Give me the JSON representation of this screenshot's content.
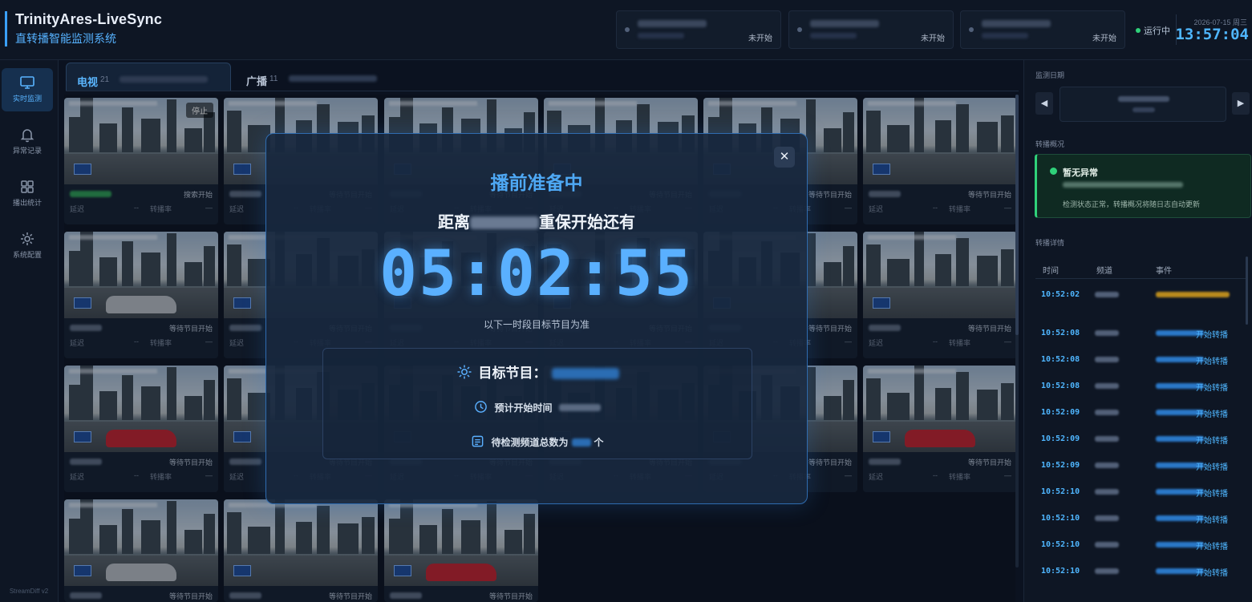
{
  "app": {
    "title": "TrinityAres-LiveSync",
    "subtitle": "直转播智能监测系统",
    "status": "运行中",
    "date": "2026-07-15 周三",
    "time": "13:57:04",
    "footnote": "StreamDiff v2"
  },
  "header_tasks": [
    {
      "state": "未开始"
    },
    {
      "state": "未开始"
    },
    {
      "state": "未开始"
    }
  ],
  "sidebar": {
    "items": [
      {
        "label": "实时监测",
        "icon": "monitor-icon",
        "active": true
      },
      {
        "label": "异常记录",
        "icon": "bell-icon"
      },
      {
        "label": "播出统计",
        "icon": "grid-icon"
      },
      {
        "label": "系统配置",
        "icon": "gear-icon"
      }
    ]
  },
  "tabs": [
    {
      "label": "电视",
      "count": "21",
      "active": true
    },
    {
      "label": "广播",
      "count": "11"
    }
  ],
  "cell_labels": {
    "stop": "停止",
    "latency": "延迟",
    "dash": "--",
    "rate": "转播率",
    "em": "—"
  },
  "channels": [
    {
      "status": "搜索开始",
      "green": true,
      "car": "none"
    },
    {
      "status": "等待节目开始",
      "car": "none"
    },
    {
      "status": "等待节目开始",
      "car": "none"
    },
    {
      "status": "等待节目开始",
      "car": "none"
    },
    {
      "status": "等待节目开始",
      "car": "none"
    },
    {
      "status": "等待节目开始",
      "car": "none"
    },
    {
      "status": "等待节目开始",
      "car": "white"
    },
    {
      "status": "等待节目开始",
      "car": "none"
    },
    {
      "status": "等待节目开始",
      "car": "none"
    },
    {
      "status": "等待节目开始",
      "car": "none"
    },
    {
      "status": "等待节目开始",
      "car": "none"
    },
    {
      "status": "等待节目开始",
      "car": "none"
    },
    {
      "status": "等待节目开始",
      "car": "red"
    },
    {
      "status": "等待节目开始",
      "car": "none"
    },
    {
      "status": "等待节目开始",
      "car": "none"
    },
    {
      "status": "等待节目开始",
      "car": "none"
    },
    {
      "status": "等待节目开始",
      "car": "none"
    },
    {
      "status": "等待节目开始",
      "car": "red"
    },
    {
      "status": "等待节目开始",
      "car": "white"
    },
    {
      "status": "等待节目开始",
      "car": "none"
    },
    {
      "status": "等待节目开始",
      "car": "red"
    }
  ],
  "right": {
    "date_label": "监测日期",
    "overview_label": "转播概况",
    "overview_title": "暂无异常",
    "overview_desc": "检测状态正常，转播概况将随日志自动更新",
    "detail_label": "转播详情",
    "columns": [
      "时间",
      "频道",
      "事件"
    ],
    "event_suffix": "开始转播",
    "log": [
      {
        "time": "10:52:02"
      },
      {
        "time": "10:52:08"
      },
      {
        "time": "10:52:08"
      },
      {
        "time": "10:52:08"
      },
      {
        "time": "10:52:09"
      },
      {
        "time": "10:52:09"
      },
      {
        "time": "10:52:09"
      },
      {
        "time": "10:52:10"
      },
      {
        "time": "10:52:10"
      },
      {
        "time": "10:52:10"
      },
      {
        "time": "10:52:10"
      }
    ]
  },
  "modal": {
    "title": "播前准备中",
    "sub_prefix": "距离",
    "sub_suffix": "重保开始还有",
    "countdown": "05:02:55",
    "note": "以下一时段目标节目为准",
    "target_label": "目标节目：",
    "start_label": "预计开始时间",
    "count_prefix": "待检测频道总数为",
    "count_suffix": "个"
  },
  "colors": {
    "accent": "#4fb6ff",
    "ok": "#2fd17a",
    "bg": "#0b1220"
  }
}
